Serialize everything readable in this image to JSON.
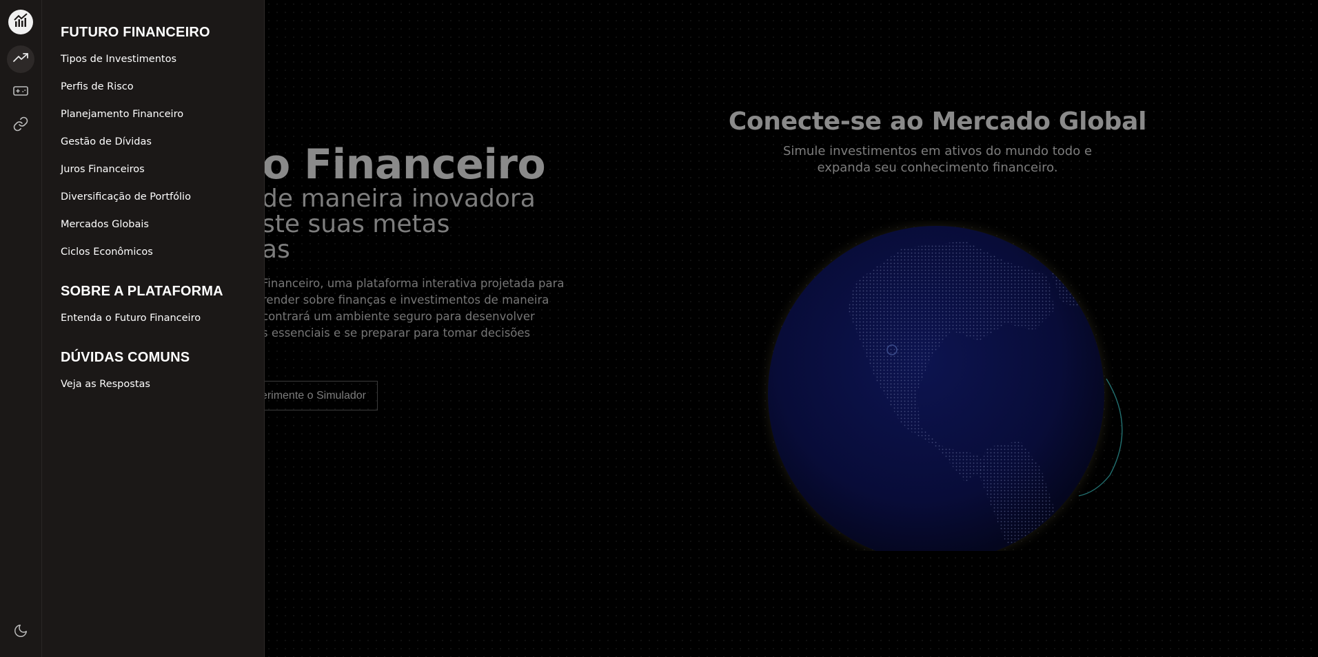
{
  "hero": {
    "title": "o Financeiro",
    "subtitle_lines": [
      "de maneira inovadora",
      "ste suas metas",
      "as"
    ],
    "description_lines": [
      "Financeiro, uma plataforma interativa projetada para",
      "render sobre finanças e investimentos de maneira",
      "contrará um ambiente seguro para desenvolver",
      "s essenciais e se preparar para tomar decisões",
      "."
    ],
    "button_label": "erimente o Simulador"
  },
  "global_section": {
    "title": "Conecte-se ao Mercado Global",
    "description_lines": [
      "Simule investimentos em ativos do mundo todo e",
      "expanda seu conhecimento financeiro."
    ]
  },
  "rail": {
    "icons": [
      "chart-logo-icon",
      "trending-up-icon",
      "gamepad-icon",
      "link-icon",
      "moon-icon"
    ]
  },
  "menu": {
    "sections": [
      {
        "title": "FUTURO FINANCEIRO",
        "items": [
          "Tipos de Investimentos",
          "Perfis de Risco",
          "Planejamento Financeiro",
          "Gestão de Dívidas",
          "Juros Financeiros",
          "Diversificação de Portfólio",
          "Mercados Globais",
          "Ciclos Econômicos"
        ]
      },
      {
        "title": "SOBRE A PLATAFORMA",
        "items": [
          "Entenda o Futuro Financeiro"
        ]
      },
      {
        "title": "DÚVIDAS COMUNS",
        "items": [
          "Veja as Respostas"
        ]
      }
    ]
  },
  "colors": {
    "sidebar_bg": "#1b1817",
    "globe": "#0a0f3a",
    "orbit_accent": "#2a8c8c"
  }
}
